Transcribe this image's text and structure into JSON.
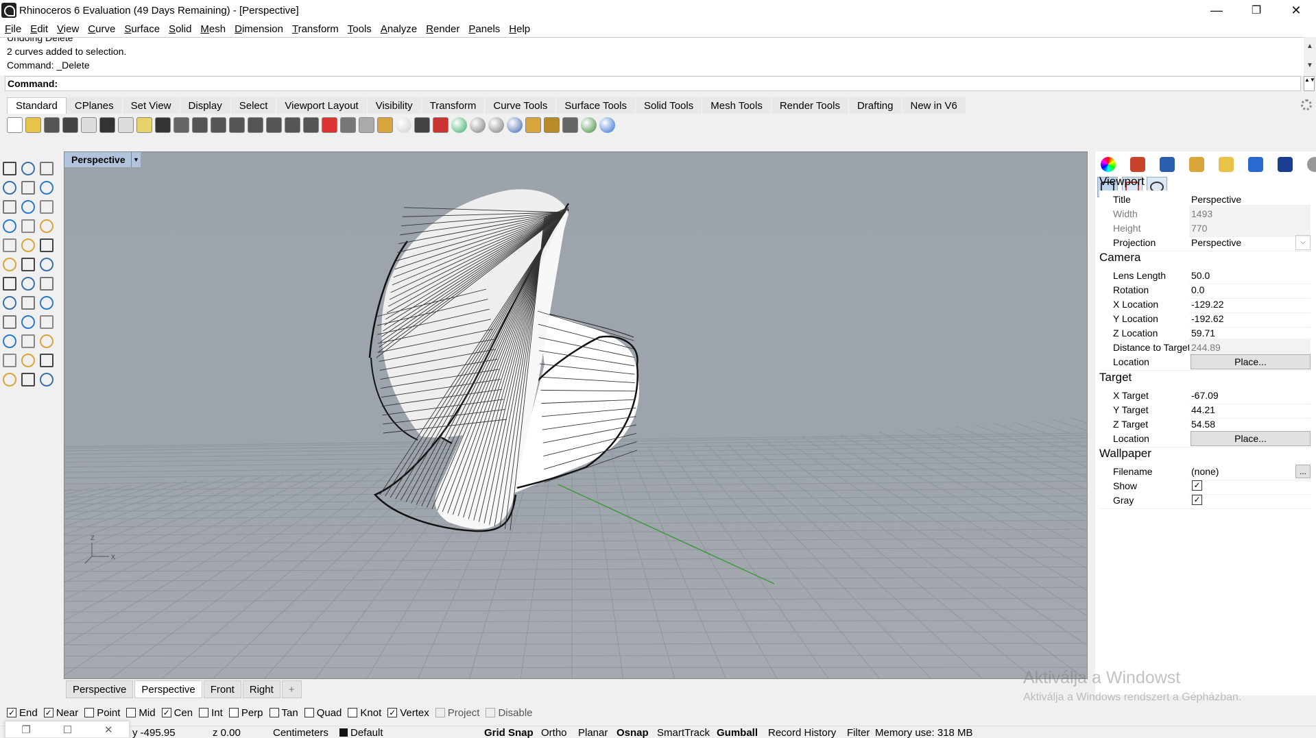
{
  "window": {
    "title": "Rhinoceros 6 Evaluation (49 Days Remaining) - [Perspective]",
    "minimize_glyph": "—",
    "maximize_glyph": "❐",
    "close_glyph": "✕"
  },
  "menu": [
    "File",
    "Edit",
    "View",
    "Curve",
    "Surface",
    "Solid",
    "Mesh",
    "Dimension",
    "Transform",
    "Tools",
    "Analyze",
    "Render",
    "Panels",
    "Help"
  ],
  "history": {
    "lines": [
      "Undoing Delete",
      "2 curves added to selection.",
      "Command: _Delete"
    ],
    "scroll_up": "▲",
    "scroll_down": "▼"
  },
  "command": {
    "label": "Command:",
    "value": "",
    "spin_glyph": "▲▼"
  },
  "toolbar_tabs": [
    "Standard",
    "CPlanes",
    "Set View",
    "Display",
    "Select",
    "Viewport Layout",
    "Visibility",
    "Transform",
    "Curve Tools",
    "Surface Tools",
    "Solid Tools",
    "Mesh Tools",
    "Render Tools",
    "Drafting",
    "New in V6"
  ],
  "toolbar_icons": [
    "new-file",
    "open-file",
    "save",
    "print",
    "import",
    "cut",
    "copy",
    "paste",
    "undo",
    "pan",
    "rotate-view",
    "zoom-dynamic",
    "zoom-window",
    "zoom-extents",
    "zoom-selected",
    "zoom-all",
    "viewport-layout",
    "car-shaded",
    "bug-ghosted",
    "object-props",
    "snap",
    "light",
    "lock",
    "layers",
    "color-wheel",
    "render-sphere",
    "material",
    "render-preview",
    "hammer-tool",
    "options-gear",
    "dimension",
    "globe",
    "help"
  ],
  "left_tools": [
    [
      "select-arrow",
      "point",
      "polyline"
    ],
    [
      "curve-cv",
      "circle",
      "ellipse"
    ],
    [
      "polygon",
      "rectangle",
      "arc"
    ],
    [
      "fillet-curve",
      "extrude-surface",
      "loft"
    ],
    [
      "box",
      "sphere",
      "cylinder"
    ],
    [
      "mesh-plane",
      "boolean",
      "explode"
    ],
    [
      "trim",
      "split",
      "join"
    ],
    [
      "group",
      "curve-edit",
      "rebuild"
    ],
    [
      "text",
      "dimension",
      "array"
    ],
    [
      "offset",
      "rotate",
      "scale"
    ],
    [
      "grid-array",
      "orient",
      "flow"
    ],
    [
      "check",
      "analyze",
      "render"
    ]
  ],
  "viewport": {
    "title": "Perspective",
    "dropdown_glyph": "▼",
    "axis_z": "z",
    "axis_x": "x"
  },
  "viewport_tabs": [
    {
      "label": "Perspective",
      "active": false
    },
    {
      "label": "Perspective",
      "active": true
    },
    {
      "label": "Front",
      "active": false
    },
    {
      "label": "Right",
      "active": false
    }
  ],
  "add_tab_glyph": "+",
  "panel": {
    "top_icons": [
      "color-wheel-icon",
      "layers-icon",
      "render-icon",
      "brush-icon",
      "folder-icon",
      "monitor-icon",
      "bell-icon",
      "gear-icon"
    ],
    "sub_icons": [
      "camera-icon",
      "rectangle-icon",
      "settings-icon"
    ],
    "viewport_section": "Viewport",
    "title_label": "Title",
    "title_value": "Perspective",
    "width_label": "Width",
    "width_value": "1493",
    "height_label": "Height",
    "height_value": "770",
    "projection_label": "Projection",
    "projection_value": "Perspective",
    "camera_section": "Camera",
    "lens_label": "Lens Length",
    "lens_value": "50.0",
    "rotation_label": "Rotation",
    "rotation_value": "0.0",
    "xloc_label": "X Location",
    "xloc_value": "-129.22",
    "yloc_label": "Y Location",
    "yloc_value": "-192.62",
    "zloc_label": "Z Location",
    "zloc_value": "59.71",
    "dist_label": "Distance to Target",
    "dist_value": "244.89",
    "loc_label": "Location",
    "place_label": "Place...",
    "target_section": "Target",
    "xt_label": "X Target",
    "xt_value": "-67.09",
    "yt_label": "Y Target",
    "yt_value": "44.21",
    "zt_label": "Z Target",
    "zt_value": "54.58",
    "loc2_label": "Location",
    "place2_label": "Place...",
    "wallpaper_section": "Wallpaper",
    "filename_label": "Filename",
    "filename_value": "(none)",
    "browse_label": "...",
    "show_label": "Show",
    "show_checked": true,
    "gray_label": "Gray",
    "gray_checked": true,
    "check_glyph": "✓",
    "dropdown_glyph": "⌵"
  },
  "watermark": {
    "line1": "Aktiválja a Windowst",
    "line2": "Aktiválja a Windows rendszert a Gépházban."
  },
  "osnap": [
    {
      "label": "End",
      "checked": true
    },
    {
      "label": "Near",
      "checked": true
    },
    {
      "label": "Point",
      "checked": false
    },
    {
      "label": "Mid",
      "checked": false
    },
    {
      "label": "Cen",
      "checked": true
    },
    {
      "label": "Int",
      "checked": false
    },
    {
      "label": "Perp",
      "checked": false
    },
    {
      "label": "Tan",
      "checked": false
    },
    {
      "label": "Quad",
      "checked": false
    },
    {
      "label": "Knot",
      "checked": false
    },
    {
      "label": "Vertex",
      "checked": true
    },
    {
      "label": "Project",
      "checked": false,
      "disabled": true
    },
    {
      "label": "Disable",
      "checked": false,
      "disabled": true
    }
  ],
  "status": {
    "y": "y -495.95",
    "z": "z 0.00",
    "units": "Centimeters",
    "layer": "Default",
    "grid_snap": "Grid Snap",
    "ortho": "Ortho",
    "planar": "Planar",
    "osnap": "Osnap",
    "smarttrack": "SmartTrack",
    "gumball": "Gumball",
    "record_history": "Record History",
    "filter": "Filter",
    "memory": "Memory use: 318 MB"
  },
  "mini_window": {
    "restore": "❐",
    "max": "☐",
    "close": "✕"
  },
  "colors": {
    "viewport_bg": "#9ea4ac",
    "viewport_title_bg": "#b0c4de",
    "grid_line": "#8f959c",
    "x_axis": "#3a9a3a"
  }
}
